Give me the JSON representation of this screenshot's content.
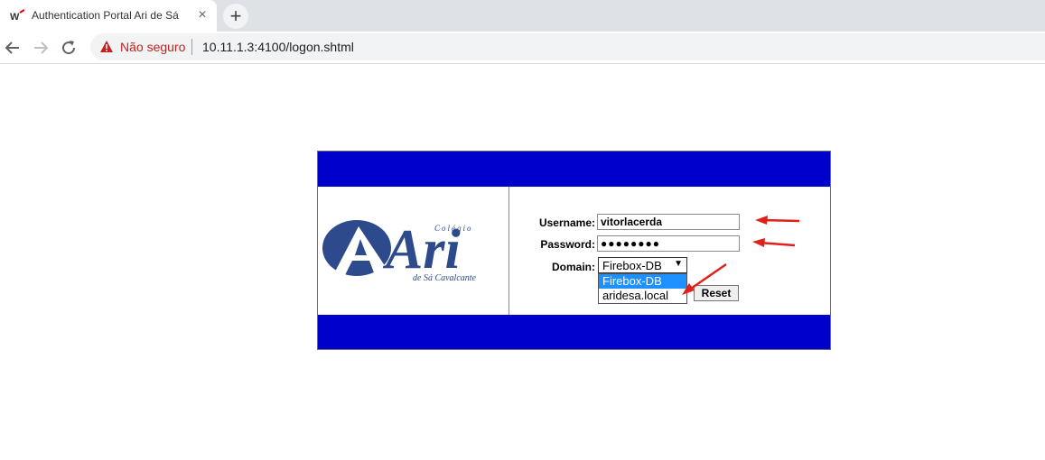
{
  "browser": {
    "tab_title": "Authentication Portal Ari de Sá",
    "new_tab_label": "+",
    "close_label": "×",
    "security_label": "Não seguro",
    "url": "10.11.1.3:4100/logon.shtml"
  },
  "logo": {
    "big_text": "Ari",
    "top_text": "Colégio",
    "bottom_text": "de Sá Cavalcante"
  },
  "form": {
    "username_label": "Username:",
    "username_value": "vitorlacerda",
    "password_label": "Password:",
    "password_value": "●●●●●●●●",
    "domain_label": "Domain:",
    "domain_selected": "Firebox-DB",
    "domain_options": [
      "Firebox-DB",
      "aridesa.local"
    ],
    "reset_label": "Reset"
  },
  "colors": {
    "portal_blue": "#0000cc",
    "logo_blue": "#2c4a8c",
    "annotation_red": "#e0201a",
    "option_highlight": "#1e90ff"
  }
}
